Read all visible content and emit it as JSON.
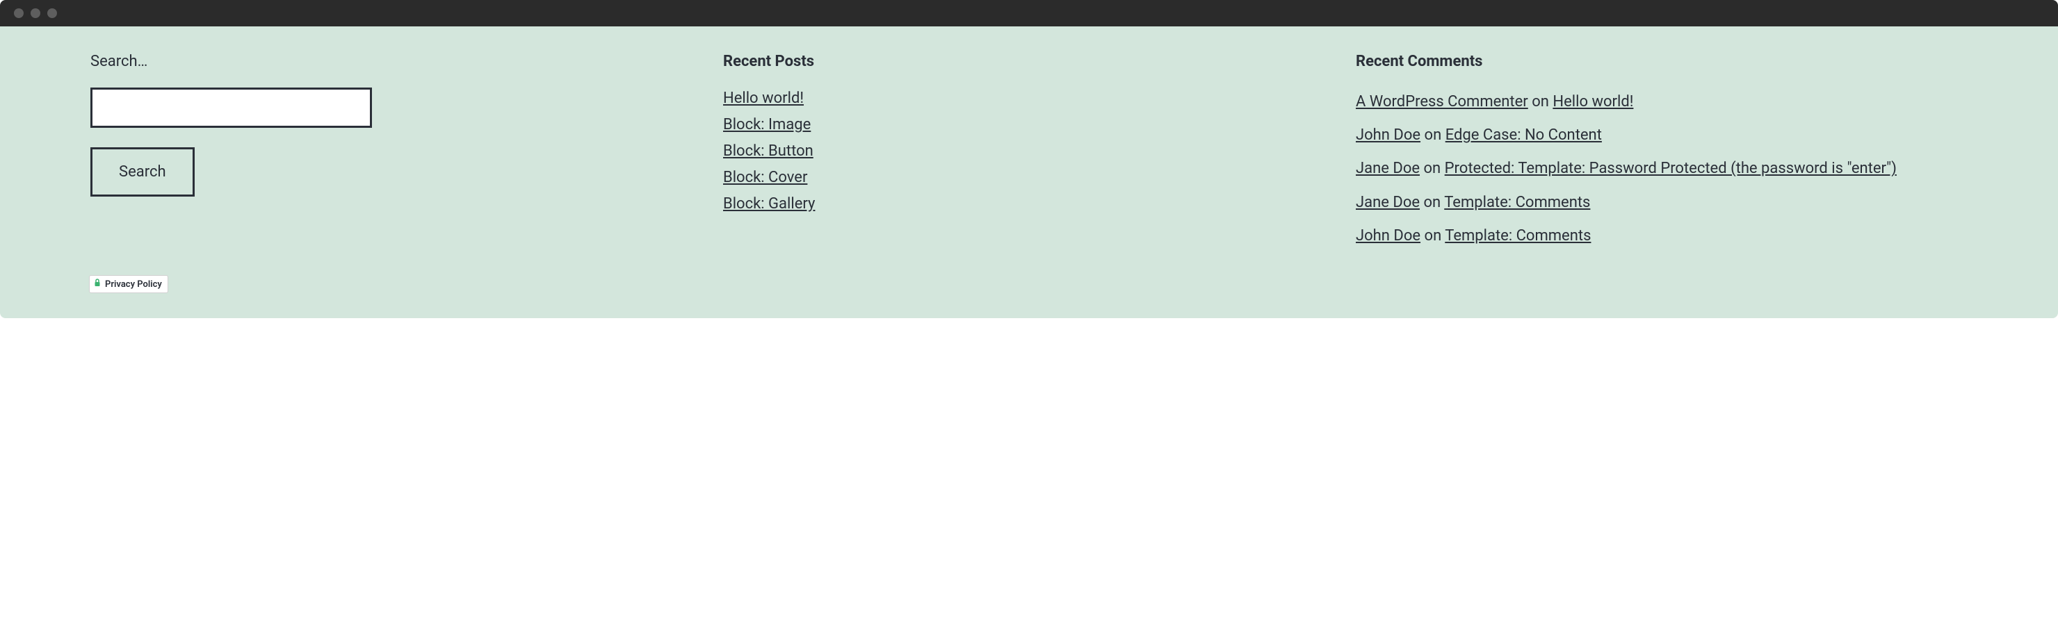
{
  "search": {
    "label": "Search…",
    "button": "Search",
    "value": ""
  },
  "recent_posts": {
    "heading": "Recent Posts",
    "items": [
      "Hello world!",
      "Block: Image",
      "Block: Button",
      "Block: Cover",
      "Block: Gallery"
    ]
  },
  "recent_comments": {
    "heading": "Recent Comments",
    "on_text": "on",
    "items": [
      {
        "author": "A WordPress Commenter",
        "post": "Hello world!"
      },
      {
        "author": "John Doe",
        "post": "Edge Case: No Content"
      },
      {
        "author": "Jane Doe",
        "post": "Protected: Template: Password Protected (the password is \"enter\")"
      },
      {
        "author": "Jane Doe",
        "post": "Template: Comments"
      },
      {
        "author": "John Doe",
        "post": "Template: Comments"
      }
    ]
  },
  "privacy": {
    "label": "Privacy Policy"
  }
}
